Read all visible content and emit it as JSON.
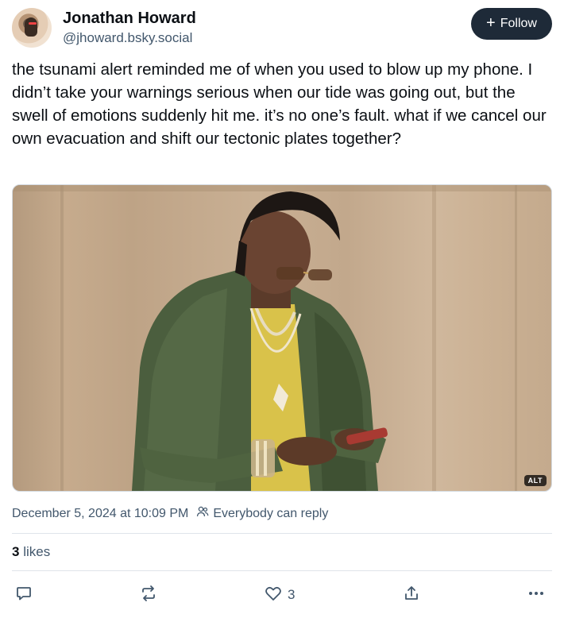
{
  "author": {
    "display_name": "Jonathan Howard",
    "handle": "@jhoward.bsky.social",
    "follow_label": "Follow"
  },
  "post": {
    "text": "the tsunami alert reminded me of when you used to blow up my phone. I didn’t take your warnings serious when our tide was going out, but the swell of emotions suddenly hit me. it’s no one’s fault. what if we cancel our own evacuation and shift our tectonic plates together?",
    "image_alt_badge": "ALT",
    "timestamp": "December 5, 2024 at 10:09 PM",
    "reply_setting": "Everybody can reply"
  },
  "stats": {
    "likes_count": "3",
    "likes_label": "likes"
  },
  "actions": {
    "like_count": "3"
  },
  "colors": {
    "follow_button_bg": "#1e2a38",
    "secondary_text": "#42576c",
    "divider": "#dfe4ea"
  },
  "icons": [
    "plus-icon",
    "people-icon",
    "reply-icon",
    "repost-icon",
    "heart-icon",
    "share-icon",
    "more-icon"
  ]
}
